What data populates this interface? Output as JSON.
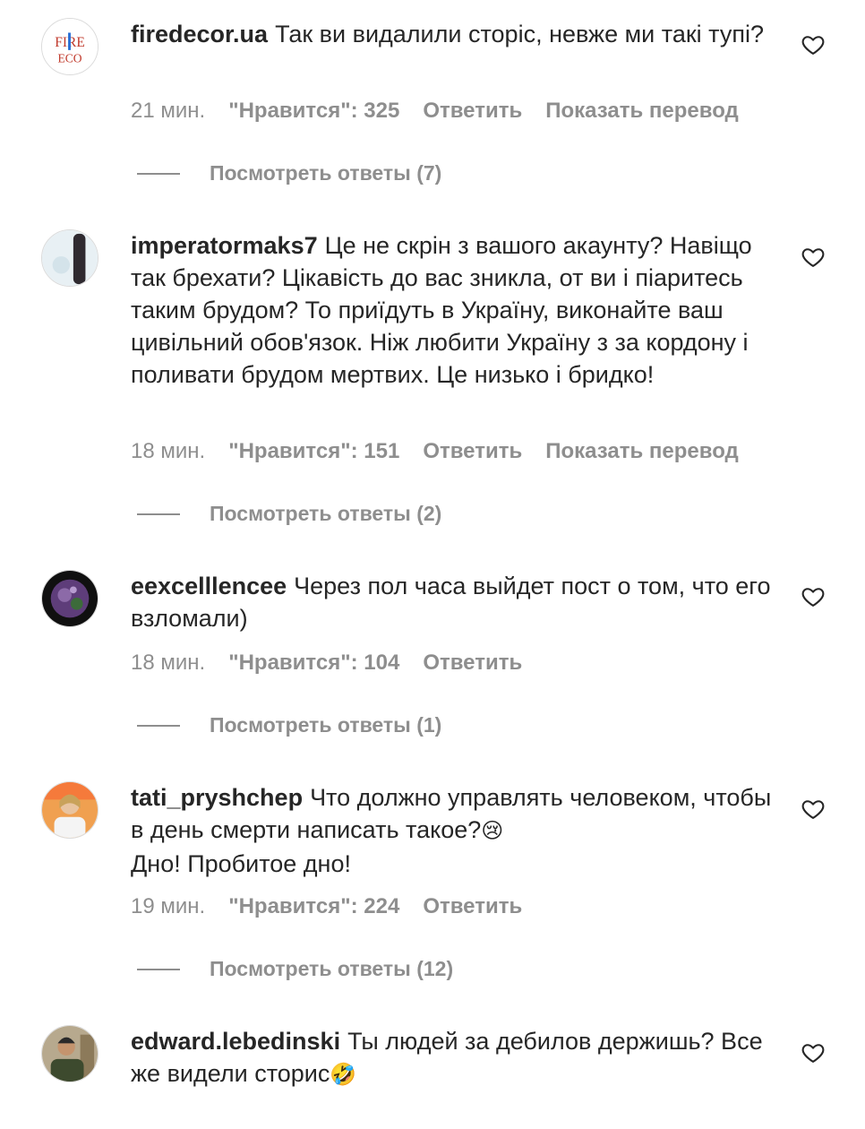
{
  "comments": [
    {
      "username": "firedecor.ua",
      "text": "Так ви видалили сторіс, невже ми такі тупі?",
      "time": "21 мин.",
      "likes": "\"Нравится\": 325",
      "reply": "Ответить",
      "translate": "Показать перевод",
      "view_replies": "Посмотреть ответы (7)",
      "avatar_text_1": "FIRE",
      "avatar_text_2": "ECO"
    },
    {
      "username": "imperatormaks7",
      "text": "Це не скрін з вашого акаунту? Навіщо так брехати? Цікавість до вас зникла, от ви і піаритесь таким брудом? То приїдуть в Україну, виконайте ваш цивільний обов'язок. Ніж любити Україну з за кордону і поливати брудом мертвих. Це низько і бридко!",
      "time": "18 мин.",
      "likes": "\"Нравится\": 151",
      "reply": "Ответить",
      "translate": "Показать перевод",
      "view_replies": "Посмотреть ответы (2)"
    },
    {
      "username": "eexcelllencee",
      "text": "Через пол часа выйдет пост о том, что его взломали)",
      "time": "18 мин.",
      "likes": "\"Нравится\": 104",
      "reply": "Ответить",
      "view_replies": "Посмотреть ответы (1)"
    },
    {
      "username": "tati_pryshchep",
      "text_line1": "Что должно управлять человеком, чтобы в день смерти написать такое?",
      "emoji1": "😢",
      "text_line2": "Дно! Пробитое дно!",
      "time": "19 мин.",
      "likes": "\"Нравится\": 224",
      "reply": "Ответить",
      "view_replies": "Посмотреть ответы (12)"
    },
    {
      "username": "edward.lebedinski",
      "text": "Ты людей за дебилов держишь? Все же видели сторис",
      "emoji1": "🤣"
    }
  ],
  "icons": {
    "like": "heart-outline-icon"
  },
  "colors": {
    "text": "#262626",
    "secondary": "#8e8e8e"
  }
}
